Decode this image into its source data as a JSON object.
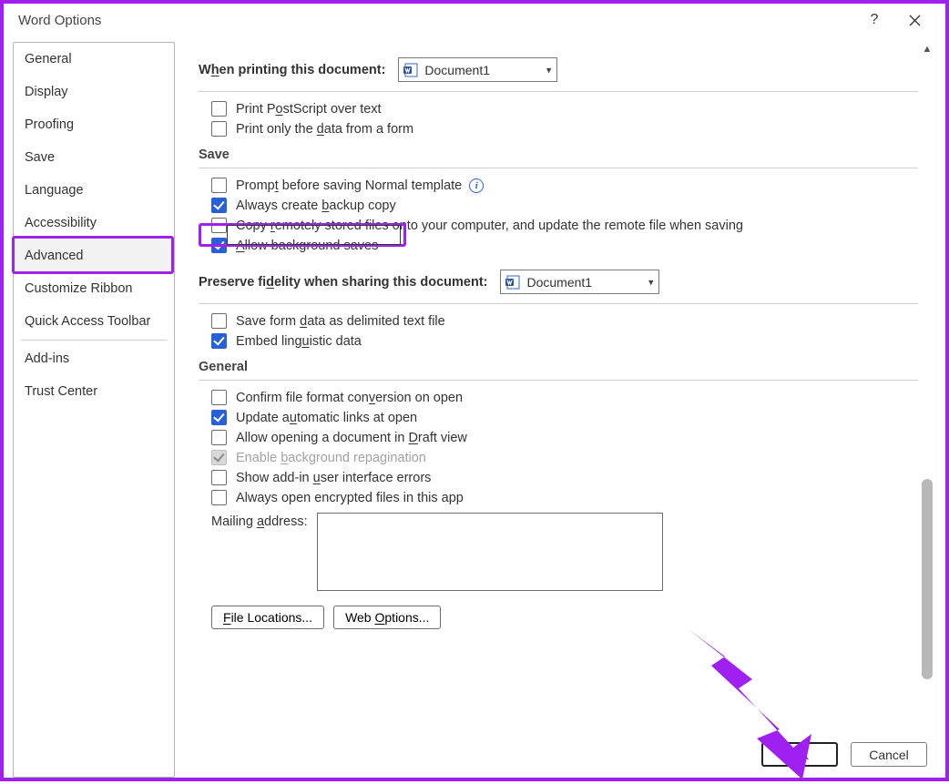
{
  "title": "Word Options",
  "titlebar": {
    "help": "?",
    "close": "✕"
  },
  "sidebar": {
    "items": [
      {
        "label": "General"
      },
      {
        "label": "Display"
      },
      {
        "label": "Proofing"
      },
      {
        "label": "Save"
      },
      {
        "label": "Language"
      },
      {
        "label": "Accessibility"
      },
      {
        "label": "Advanced",
        "selected": true
      },
      {
        "label": "Customize Ribbon"
      },
      {
        "label": "Quick Access Toolbar"
      },
      {
        "label": "Add-ins"
      },
      {
        "label": "Trust Center"
      }
    ]
  },
  "printing": {
    "heading_prefix": "W",
    "heading_mid": "h",
    "heading_rest": "en printing this document:",
    "doc": "Document1",
    "opt_postscript": "Print PostScript over text",
    "opt_postscript_u": "o",
    "opt_dataform": "Print only the data from a form",
    "opt_dataform_u": "d"
  },
  "save": {
    "heading": "Save",
    "opt_prompt": "Prompt before saving Normal template",
    "opt_prompt_u": "t",
    "opt_backup": "Always create backup copy",
    "opt_backup_u": "b",
    "opt_remote": "Copy remotely stored files onto your computer, and update the remote file when saving",
    "opt_remote_u": "r",
    "opt_bgsave": "Allow background saves",
    "opt_bgsave_u": "A"
  },
  "fidelity": {
    "heading": "Preserve fidelity when sharing this document:",
    "heading_u": "d",
    "doc": "Document1",
    "opt_delimited": "Save form data as delimited text file",
    "opt_delimited_u": "d",
    "opt_linguistic": "Embed linguistic data",
    "opt_linguistic_u": "u"
  },
  "general": {
    "heading": "General",
    "opt_confirm": "Confirm file format conversion on open",
    "opt_confirm_u": "v",
    "opt_autolinks": "Update automatic links at open",
    "opt_autolinks_u": "u",
    "opt_draft": "Allow opening a document in Draft view",
    "opt_draft_u": "D",
    "opt_repag": "Enable background repagination",
    "opt_repag_u": "b",
    "opt_addin": "Show add-in user interface errors",
    "opt_addin_u": "u",
    "opt_encrypted": "Always open encrypted files in this app",
    "mailing_label": "Mailing address:",
    "mailing_label_u": "a",
    "file_locations": "File Locations...",
    "file_locations_u": "F",
    "web_options": "Web Options...",
    "web_options_u": "O"
  },
  "footer": {
    "ok": "OK",
    "cancel": "Cancel"
  }
}
